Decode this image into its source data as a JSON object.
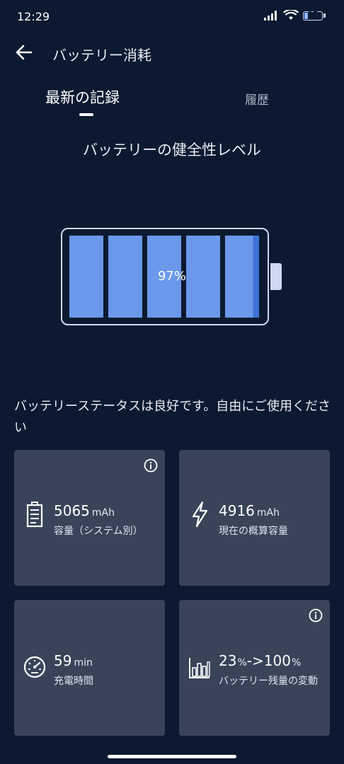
{
  "status_bar": {
    "time": "12:29",
    "battery_level": "17"
  },
  "header": {
    "title": "バッテリー消耗"
  },
  "tabs": [
    {
      "label": "最新の記録",
      "active": true
    },
    {
      "label": "履歴",
      "active": false
    }
  ],
  "health": {
    "title": "バッテリーの健全性レベル",
    "percent_text": "97%",
    "level": 0.97
  },
  "status_message": "バッテリーステータスは良好です。自由にご使用ください",
  "cards": {
    "capacity": {
      "value": "5065",
      "unit": "mAh",
      "label": "容量（システム別）"
    },
    "current_capacity": {
      "value": "4916",
      "unit": "mAh",
      "label": "現在の概算容量"
    },
    "charge_time": {
      "value": "59",
      "unit": "min",
      "label": "充電時間"
    },
    "level_change": {
      "from": "23",
      "from_unit": "%",
      "arrow": "->",
      "to": "100",
      "to_unit": "%",
      "label": "バッテリー残量の変動"
    }
  },
  "colors": {
    "background": "#0b1a30",
    "card": "#394459",
    "battery_fill": "#6b98ea",
    "battery_outline": "#cfd8f2"
  }
}
